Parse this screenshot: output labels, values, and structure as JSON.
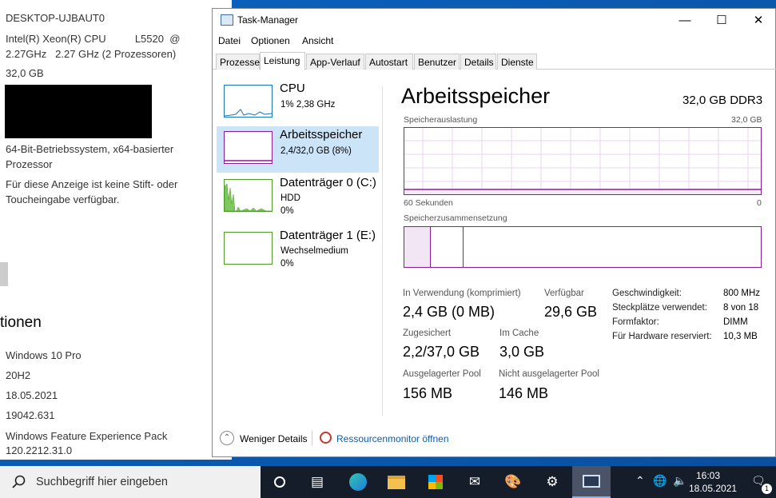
{
  "background_window": {
    "computer_name": "DESKTOP-UJBAUT0",
    "cpu_line1": "Intel(R) Xeon(R) CPU          L5520  @",
    "cpu_line2": "2.27GHz   2.27 GHz (2 Prozessoren)",
    "ram": "32,0 GB",
    "os_type_line1": "64-Bit-Betriebssystem, x64-basierter",
    "os_type_line2": "Prozessor",
    "pen_line1": "Für diese Anzeige ist keine Stift- oder",
    "pen_line2": "Toucheingabe verfügbar.",
    "section_heading": "tionen",
    "edition": "Windows 10 Pro",
    "version": "20H2",
    "installed_on": "18.05.2021",
    "build": "19042.631",
    "experience_line1": "Windows Feature Experience Pack",
    "experience_line2": "120.2212.31.0"
  },
  "task_manager": {
    "title": "Task-Manager",
    "menu": [
      "Datei",
      "Optionen",
      "Ansicht"
    ],
    "tabs": [
      "Prozesse",
      "Leistung",
      "App-Verlauf",
      "Autostart",
      "Benutzer",
      "Details",
      "Dienste"
    ],
    "active_tab": "Leistung",
    "sidebar": [
      {
        "name": "CPU",
        "sub1": "1% 2,38 GHz",
        "sub2": ""
      },
      {
        "name": "Arbeitsspeicher",
        "sub1": "2,4/32,0 GB (8%)",
        "sub2": ""
      },
      {
        "name": "Datenträger 0 (C:)",
        "sub1": "HDD",
        "sub2": "0%"
      },
      {
        "name": "Datenträger 1 (E:)",
        "sub1": "Wechselmedium",
        "sub2": "0%"
      }
    ],
    "main": {
      "title": "Arbeitsspeicher",
      "capacity": "32,0 GB DDR3",
      "usage_label": "Speicherauslastung",
      "usage_max": "32,0 GB",
      "time_left": "60 Sekunden",
      "time_right": "0",
      "composition_label": "Speicherzusammensetzung",
      "stats": {
        "in_use_label": "In Verwendung (komprimiert)",
        "in_use": "2,4 GB (0 MB)",
        "available_label": "Verfügbar",
        "available": "29,6 GB",
        "committed_label": "Zugesichert",
        "committed": "2,2/37,0 GB",
        "cached_label": "Im Cache",
        "cached": "3,0 GB",
        "paged_label": "Ausgelagerter Pool",
        "paged": "156 MB",
        "nonpaged_label": "Nicht ausgelagerter Pool",
        "nonpaged": "146 MB"
      },
      "specs": [
        {
          "key": "Geschwindigkeit:",
          "value": "800 MHz"
        },
        {
          "key": "Steckplätze verwendet:",
          "value": "8 von 18"
        },
        {
          "key": "Formfaktor:",
          "value": "DIMM"
        },
        {
          "key": "Für Hardware reserviert:",
          "value": "10,3 MB"
        }
      ]
    },
    "footer": {
      "fewer_details": "Weniger Details",
      "resource_monitor": "Ressourcenmonitor öffnen"
    },
    "accent_color": "#8b1c99"
  },
  "taskbar": {
    "search_placeholder": "Suchbegriff hier eingeben",
    "time": "16:03",
    "date": "18.05.2021",
    "notification_count": "1"
  }
}
